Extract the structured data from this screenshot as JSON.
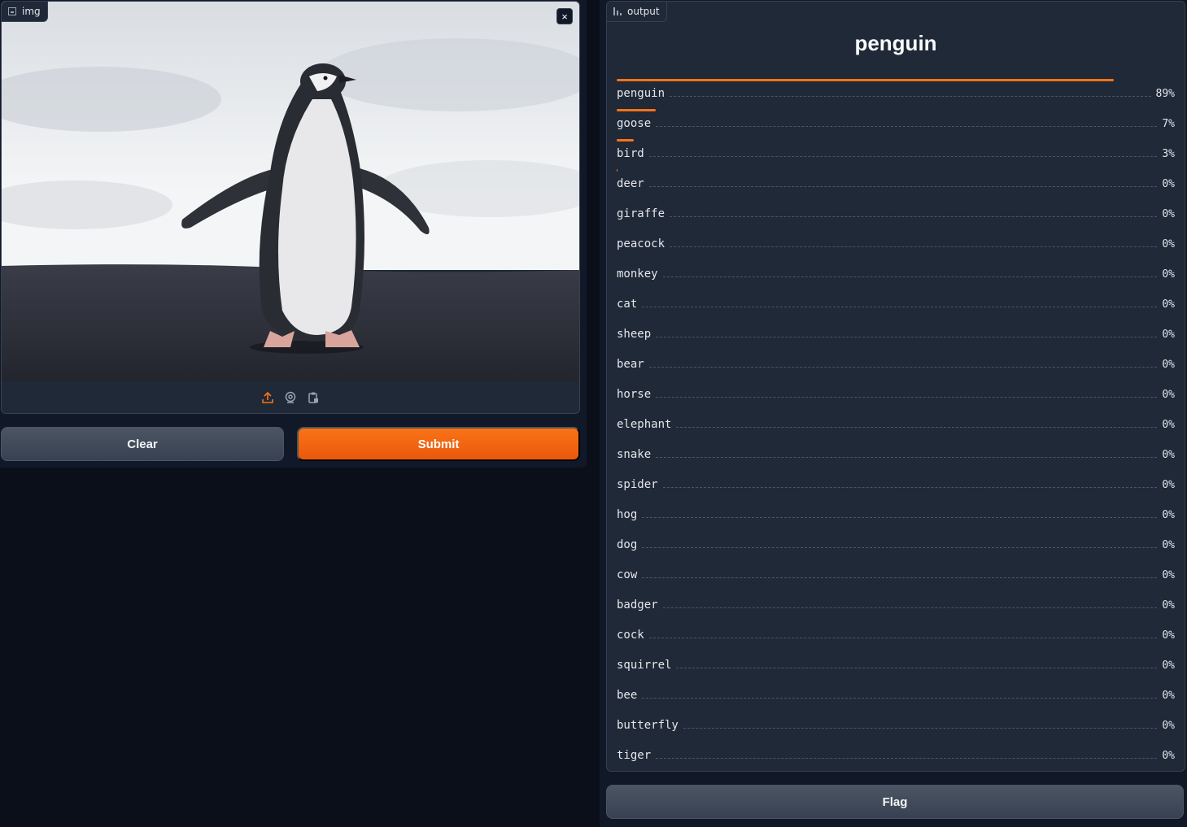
{
  "input": {
    "label": "img",
    "close_symbol": "×"
  },
  "actions": {
    "clear_label": "Clear",
    "submit_label": "Submit",
    "flag_label": "Flag"
  },
  "output": {
    "label": "output",
    "top_label": "penguin",
    "predictions": [
      {
        "label": "penguin",
        "pct": "89%",
        "value": 0.89
      },
      {
        "label": "goose",
        "pct": "7%",
        "value": 0.07
      },
      {
        "label": "bird",
        "pct": "3%",
        "value": 0.03
      },
      {
        "label": "deer",
        "pct": "0%",
        "value": 0.002
      },
      {
        "label": "giraffe",
        "pct": "0%",
        "value": 0
      },
      {
        "label": "peacock",
        "pct": "0%",
        "value": 0
      },
      {
        "label": "monkey",
        "pct": "0%",
        "value": 0
      },
      {
        "label": "cat",
        "pct": "0%",
        "value": 0
      },
      {
        "label": "sheep",
        "pct": "0%",
        "value": 0
      },
      {
        "label": "bear",
        "pct": "0%",
        "value": 0
      },
      {
        "label": "horse",
        "pct": "0%",
        "value": 0
      },
      {
        "label": "elephant",
        "pct": "0%",
        "value": 0
      },
      {
        "label": "snake",
        "pct": "0%",
        "value": 0
      },
      {
        "label": "spider",
        "pct": "0%",
        "value": 0
      },
      {
        "label": "hog",
        "pct": "0%",
        "value": 0
      },
      {
        "label": "dog",
        "pct": "0%",
        "value": 0
      },
      {
        "label": "cow",
        "pct": "0%",
        "value": 0
      },
      {
        "label": "badger",
        "pct": "0%",
        "value": 0
      },
      {
        "label": "cock",
        "pct": "0%",
        "value": 0
      },
      {
        "label": "squirrel",
        "pct": "0%",
        "value": 0
      },
      {
        "label": "bee",
        "pct": "0%",
        "value": 0
      },
      {
        "label": "butterfly",
        "pct": "0%",
        "value": 0
      },
      {
        "label": "tiger",
        "pct": "0%",
        "value": 0
      }
    ]
  },
  "colors": {
    "accent": "#f97316",
    "panel": "#1f2937",
    "background": "#0b0f19"
  },
  "icons": [
    "image-icon",
    "close-icon",
    "upload-icon",
    "webcam-icon",
    "clipboard-icon",
    "label-icon"
  ]
}
